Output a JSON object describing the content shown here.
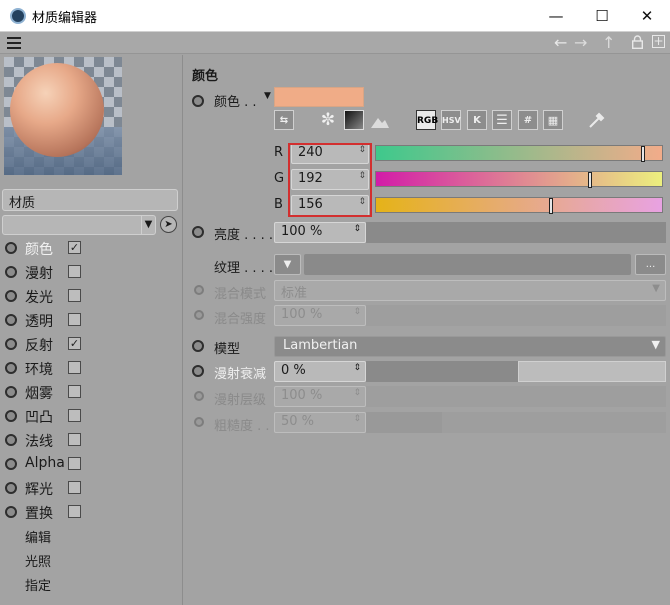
{
  "window": {
    "title": "材质编辑器",
    "minimize": "—",
    "maximize": "☐",
    "close": "✕"
  },
  "nav": {
    "back": "←",
    "forward": "→",
    "up": "↑",
    "new": "+"
  },
  "material": {
    "name": "材质"
  },
  "channels": [
    {
      "label": "颜色",
      "checked": true,
      "selected": true
    },
    {
      "label": "漫射",
      "checked": false
    },
    {
      "label": "发光",
      "checked": false
    },
    {
      "label": "透明",
      "checked": false
    },
    {
      "label": "反射",
      "checked": true
    },
    {
      "label": "环境",
      "checked": false
    },
    {
      "label": "烟雾",
      "checked": false
    },
    {
      "label": "凹凸",
      "checked": false
    },
    {
      "label": "法线",
      "checked": false
    },
    {
      "label": "Alpha",
      "checked": false
    },
    {
      "label": "辉光",
      "checked": false
    },
    {
      "label": "置换",
      "checked": false
    }
  ],
  "extra_items": [
    "编辑",
    "光照",
    "指定"
  ],
  "color_section": {
    "title": "颜色",
    "color_label": "颜色 . . ",
    "swatch_color": "#f0ac87",
    "modes": {
      "rgb": "RGB",
      "hsv": "HSV",
      "k": "K",
      "hash": "#"
    },
    "rgb": [
      {
        "channel": "R",
        "value": "240",
        "fraction": 0.941
      },
      {
        "channel": "G",
        "value": "192",
        "fraction": 0.753
      },
      {
        "channel": "B",
        "value": "156",
        "fraction": 0.612
      }
    ],
    "brightness": {
      "label": "亮度 . . . . .",
      "value": "100 %"
    },
    "texture": {
      "label": "纹理 . . . . .",
      "more": "..."
    },
    "blend_mode": {
      "label": "混合模式",
      "value": "标准"
    },
    "blend_strength": {
      "label": "混合强度",
      "value": "100 %"
    },
    "model": {
      "label": "模型",
      "value": "Lambertian"
    },
    "diffuse_falloff": {
      "label": "漫射衰减",
      "value": "0 %"
    },
    "diffuse_level": {
      "label": "漫射层级",
      "value": "100 %"
    },
    "roughness": {
      "label": "粗糙度 . . .",
      "value": "50 %"
    }
  }
}
